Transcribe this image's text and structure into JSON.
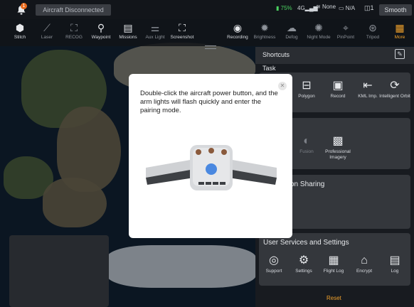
{
  "status_bar": {
    "notification_count": "1",
    "connection_status": "Aircraft Disconnected",
    "battery": "75%",
    "signal": "4G",
    "wifi_label": "None",
    "na_label": "N/A",
    "camera_count": "1",
    "mode": "Smooth",
    "colors": {
      "battery": "#4ad15f",
      "badge": "#e86a1c"
    }
  },
  "toolbar": {
    "items": [
      {
        "label": "Stitch",
        "icon": "stitch-icon"
      },
      {
        "label": "Laser",
        "icon": "laser-icon"
      },
      {
        "label": "RECOG",
        "icon": "recog-icon"
      },
      {
        "label": "Waypoint",
        "icon": "waypoint-icon"
      },
      {
        "label": "Missions",
        "icon": "missions-icon"
      },
      {
        "label": "Aux Light",
        "icon": "aux-light-icon"
      },
      {
        "label": "Screenshot",
        "icon": "screenshot-icon"
      },
      {
        "label": "Recording",
        "icon": "recording-icon"
      },
      {
        "label": "Brightness",
        "icon": "brightness-icon"
      },
      {
        "label": "Defog",
        "icon": "defog-icon"
      },
      {
        "label": "Night Mode",
        "icon": "night-mode-icon"
      },
      {
        "label": "PinPoint",
        "icon": "pinpoint-icon"
      },
      {
        "label": "Tripod",
        "icon": "tripod-icon"
      },
      {
        "label": "More",
        "icon": "more-icon"
      }
    ],
    "accent": "#f0a12b"
  },
  "panel": {
    "title": "Shortcuts",
    "task_title": "Task",
    "task_items": [
      {
        "label": "Polygon",
        "icon": "polygon-icon"
      },
      {
        "label": "Record",
        "icon": "record-icon"
      },
      {
        "label": "KML Imp.",
        "icon": "kml-import-icon"
      },
      {
        "label": "Intelligent Orbit",
        "icon": "intelligent-orbit-icon"
      }
    ],
    "camera_items": [
      {
        "label": "Fusion",
        "icon": "fusion-icon"
      },
      {
        "label": "Professional Imagery",
        "icon": "professional-imagery-icon"
      }
    ],
    "sharing_title": "on Sharing",
    "services_title": "User Services and Settings",
    "services_items": [
      {
        "label": "Support",
        "icon": "support-icon"
      },
      {
        "label": "Settings",
        "icon": "settings-icon"
      },
      {
        "label": "Flight Log",
        "icon": "flight-log-icon"
      },
      {
        "label": "Encrypt",
        "icon": "encrypt-icon"
      },
      {
        "label": "Log",
        "icon": "log-icon"
      }
    ],
    "reset_label": "Reset"
  },
  "modal": {
    "message": "Double-click the aircraft power button, and the arm lights will flash quickly and enter the pairing mode.",
    "close_icon": "close-icon"
  }
}
